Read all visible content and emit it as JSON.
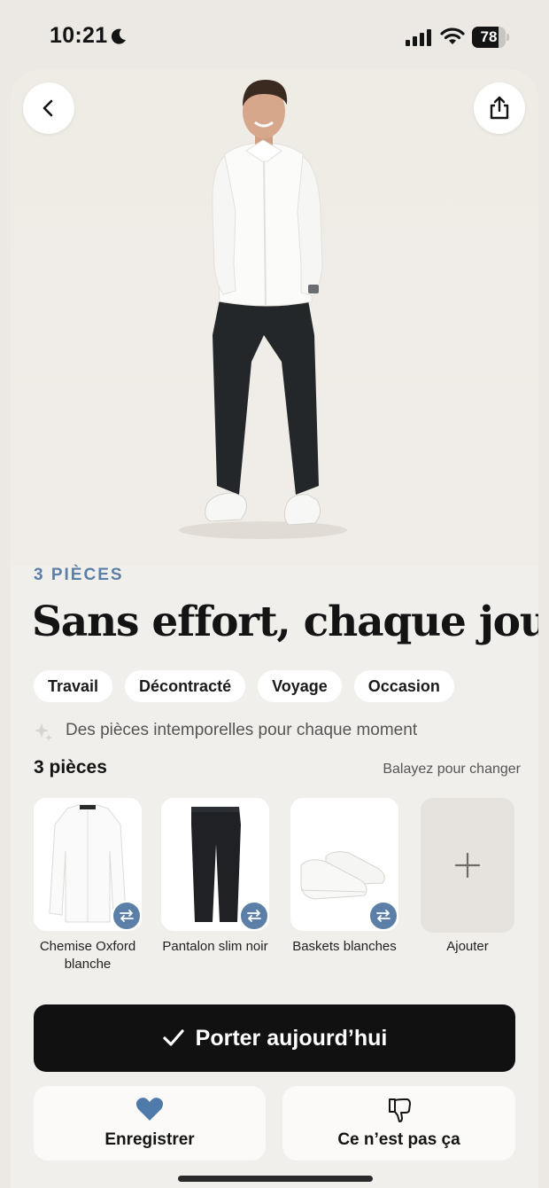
{
  "status_bar": {
    "time": "10:21",
    "battery": "78",
    "battery_level": 0.78
  },
  "header": {
    "back_icon": "chevron-left-icon",
    "share_icon": "share-icon"
  },
  "outfit": {
    "eyebrow": "3 PIÈCES",
    "title": "Sans effort, chaque jour",
    "tags": [
      "Travail",
      "Décontracté",
      "Voyage",
      "Occasion"
    ],
    "description": "Des pièces intemporelles pour chaque moment"
  },
  "pieces": {
    "heading": "3 pièces",
    "hint": "Balayez pour changer",
    "items": [
      {
        "label": "Chemise Oxford blanche",
        "icon": "shirt"
      },
      {
        "label": "Pantalon slim noir",
        "icon": "pants"
      },
      {
        "label": "Baskets blanches",
        "icon": "sneakers"
      }
    ],
    "add_label": "Ajouter"
  },
  "actions": {
    "primary": "Porter aujourd’hui",
    "save": "Enregistrer",
    "dislike": "Ce n’est pas ça"
  },
  "colors": {
    "accent": "#5b7fa6",
    "primary_button": "#111111",
    "background": "#f1efeb"
  }
}
